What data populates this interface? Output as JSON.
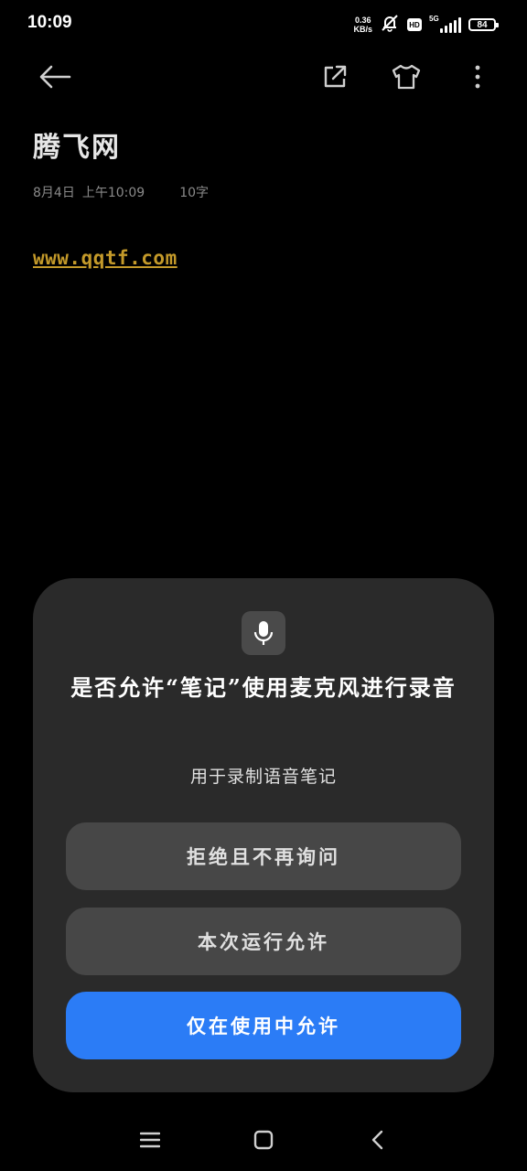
{
  "status_bar": {
    "time": "10:09",
    "net_speed_value": "0.36",
    "net_speed_unit": "KB/s",
    "hd_label": "HD",
    "network_label": "5G",
    "battery_level": "84",
    "icons": [
      "mute-icon",
      "hd-icon",
      "signal-icon",
      "battery-icon"
    ]
  },
  "appbar": {
    "icons": [
      "back-arrow-icon",
      "share-icon",
      "theme-shirt-icon",
      "more-vertical-icon"
    ]
  },
  "note": {
    "title": "腾飞网",
    "date": "8月4日",
    "time": "上午10:09",
    "word_count": "10字",
    "link_text": "www.qqtf.com"
  },
  "dialog": {
    "icon": "microphone-icon",
    "title": "是否允许“笔记”使用麦克风进行录音",
    "subtitle": "用于录制语音笔记",
    "deny_label": "拒绝且不再询问",
    "allow_once_label": "本次运行允许",
    "allow_in_use_label": "仅在使用中允许",
    "accent_color": "#2b7cf6"
  },
  "navbar": {
    "icons": [
      "menu-icon",
      "home-icon",
      "back-icon"
    ]
  }
}
